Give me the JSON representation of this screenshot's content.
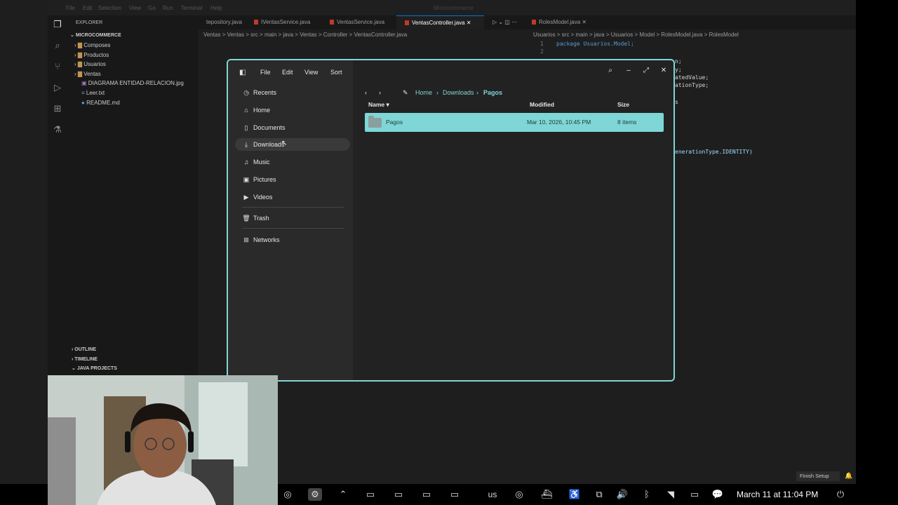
{
  "vscode": {
    "menu": [
      "File",
      "Edit",
      "Selection",
      "View",
      "Go",
      "Run",
      "Terminal",
      "Help"
    ],
    "search": "Microcommerce",
    "explorer_title": "EXPLORER",
    "project": "MICROCOMMERCE",
    "tree": [
      {
        "label": "Composes",
        "type": "folder"
      },
      {
        "label": "Productos",
        "type": "folder"
      },
      {
        "label": "Usuarios",
        "type": "folder"
      },
      {
        "label": "Ventas",
        "type": "folder"
      },
      {
        "label": "DIAGRAMA ENTIDAD-RELACION.jpg",
        "type": "image"
      },
      {
        "label": "Leer.txt",
        "type": "text"
      },
      {
        "label": "README.md",
        "type": "info"
      }
    ],
    "bottom_sections": [
      "OUTLINE",
      "TIMELINE",
      "JAVA PROJECTS"
    ],
    "tabs": [
      {
        "label": "tepository.java",
        "active": false
      },
      {
        "label": "IVentasService.java",
        "active": false
      },
      {
        "label": "VentasService.java",
        "active": false
      },
      {
        "label": "VentasController.java",
        "active": true
      },
      {
        "label": "RolesModel.java",
        "active": false
      }
    ],
    "breadcrumb_left": "Ventas > Ventas > src > main > java > Ventas > Controller > VentasController.java",
    "breadcrumb_right": "Usuarios > src > main > java > Usuarios > Model > RolesModel.java > RolesModel",
    "code_right": {
      "line1_num": "1",
      "line2_num": "2",
      "line1": "package Usuarios.Model;",
      "frag1": "n;",
      "frag2": "y;",
      "frag3": "atedValue;",
      "frag4": "ationType;",
      "frag5": "s",
      "frag6": "enerationType.IDENTITY)"
    }
  },
  "file_manager": {
    "menu": [
      "File",
      "Edit",
      "View",
      "Sort"
    ],
    "sidebar": [
      {
        "label": "Recents",
        "icon": "clock-icon"
      },
      {
        "label": "Home",
        "icon": "home-icon"
      },
      {
        "label": "Documents",
        "icon": "document-icon"
      },
      {
        "label": "Downloads",
        "icon": "download-icon",
        "active": true
      },
      {
        "label": "Music",
        "icon": "music-icon"
      },
      {
        "label": "Pictures",
        "icon": "picture-icon"
      },
      {
        "label": "Videos",
        "icon": "video-icon"
      },
      {
        "label": "Trash",
        "icon": "trash-icon"
      },
      {
        "label": "Networks",
        "icon": "network-icon"
      }
    ],
    "path": [
      "Home",
      "Downloads",
      "Pagos"
    ],
    "columns": {
      "name": "Name",
      "modified": "Modified",
      "size": "Size"
    },
    "rows": [
      {
        "name": "Pagos",
        "modified": "Mar 10, 2026, 10:45 PM",
        "size": "8 items",
        "selected": true
      }
    ],
    "accent": "#7fd6d6"
  },
  "taskbar": {
    "keyboard_layout": "us",
    "clock": "March 11 at 11:04 PM",
    "finish_setup": "Finish Setup"
  }
}
